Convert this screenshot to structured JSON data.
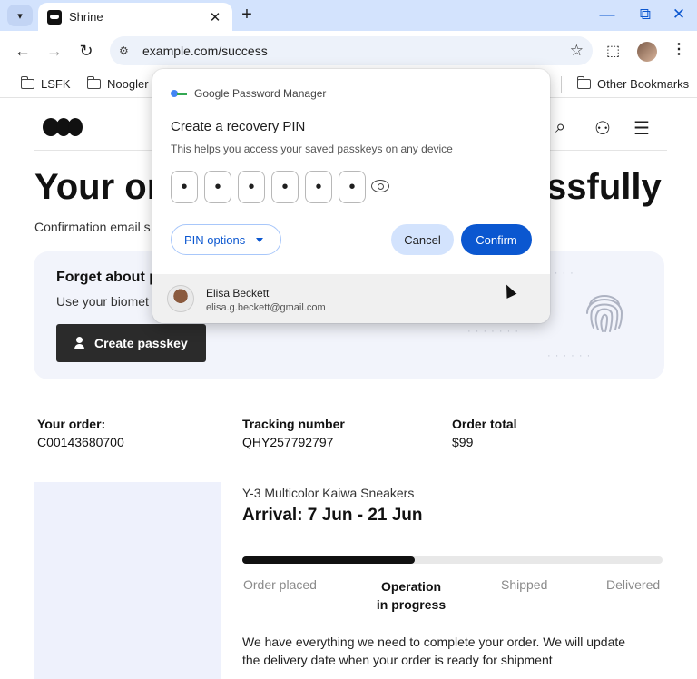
{
  "browser": {
    "tab_title": "Shrine",
    "new_tab": "+",
    "url": "example.com/success",
    "bookmarks": [
      "LSFK",
      "Noogler"
    ],
    "other_bookmarks": "Other Bookmarks"
  },
  "page": {
    "headline_left": "Your or",
    "headline_right": "ssfully",
    "confirmation_email": "Confirmation email s",
    "passkey_card": {
      "title": "Forget about p",
      "description": "Use your biomet",
      "button": "Create passkey"
    },
    "order": {
      "your_order_label": "Your order:",
      "your_order_value": "C00143680700",
      "tracking_label": "Tracking number",
      "tracking_value": "QHY257792797",
      "total_label": "Order total",
      "total_value": "$99"
    },
    "product": {
      "name": "Y-3 Multicolor Kaiwa Sneakers",
      "arrival": "Arrival: 7 Jun - 21 Jun",
      "progress_fraction": 0.41,
      "steps": {
        "placed": "Order placed",
        "operation_line1": "Operation",
        "operation_line2": "in progress",
        "shipped": "Shipped",
        "delivered": "Delivered"
      },
      "status_message": "We have everything we need to complete your order. We will update the delivery date when your order is ready for shipment"
    }
  },
  "popup": {
    "header": "Google Password Manager",
    "title": "Create a recovery PIN",
    "subtitle": "This helps you access your saved passkeys on any device",
    "pin_digits": [
      "•",
      "•",
      "•",
      "•",
      "•",
      "•"
    ],
    "pin_options": "PIN options",
    "cancel": "Cancel",
    "confirm": "Confirm",
    "account_name": "Elisa Beckett",
    "account_email": "elisa.g.beckett@gmail.com"
  },
  "colors": {
    "tabstrip": "#d3e3fd",
    "accent": "#0b57d0",
    "card_bg": "#f2f4fb",
    "product_bg": "#eef1fc"
  }
}
